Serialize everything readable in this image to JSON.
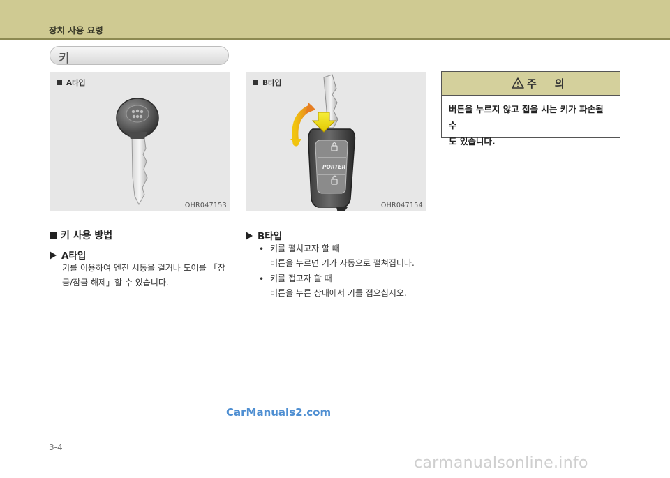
{
  "header": {
    "title": "장치 사용 요령"
  },
  "section": {
    "title": "키"
  },
  "figures": [
    {
      "label": "A타입",
      "code": "OHR047153"
    },
    {
      "label": "B타입",
      "code": "OHR047154",
      "key_brand": "PORTER"
    }
  ],
  "caution": {
    "title": "주의",
    "lines": [
      "버튼을 누르지 않고 접을 시는 키가 파손될 수",
      "도 있습니다."
    ]
  },
  "left_text": {
    "heading": "키 사용 방법",
    "type_a": "A타입",
    "lines": [
      "키를 이용하여 엔진 시동을 걸거나 도어를 「잠",
      "금/잠금 해제」할 수 있습니다."
    ]
  },
  "right_text": {
    "type_b": "B타입",
    "items": [
      {
        "bullet": "•",
        "title": "키를 펼치고자 할 때",
        "desc": "버튼을 누르면 키가 자동으로 펼쳐집니다."
      },
      {
        "bullet": "•",
        "title": "키를 접고자 할 때",
        "desc": "버튼을 누른 상태에서 키를 접으십시오."
      }
    ]
  },
  "watermarks": {
    "carmanuals": "CarManuals2.com",
    "online": "carmanualsonline.info"
  },
  "page_number": "3-4"
}
